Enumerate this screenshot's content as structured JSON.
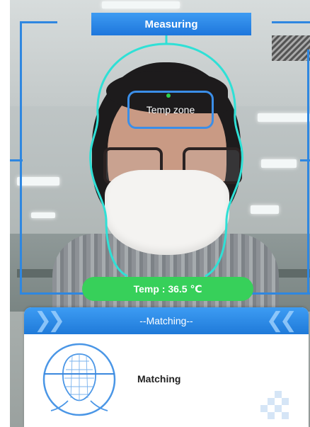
{
  "overlay": {
    "title": "Measuring",
    "temp_zone_label": "Temp zone",
    "temperature_readout": "Temp : 36.5 ℃"
  },
  "matching_panel": {
    "header": "--Matching--",
    "status": "Matching"
  },
  "icons": {
    "face_scan": "face-scan-icon",
    "chevrons": "chevron-icon"
  },
  "colors": {
    "accent_blue": "#2f87e0",
    "outline_cyan": "#2fe0d6",
    "temp_green": "#37d05a",
    "panel_blue": "#1f7ad9"
  }
}
